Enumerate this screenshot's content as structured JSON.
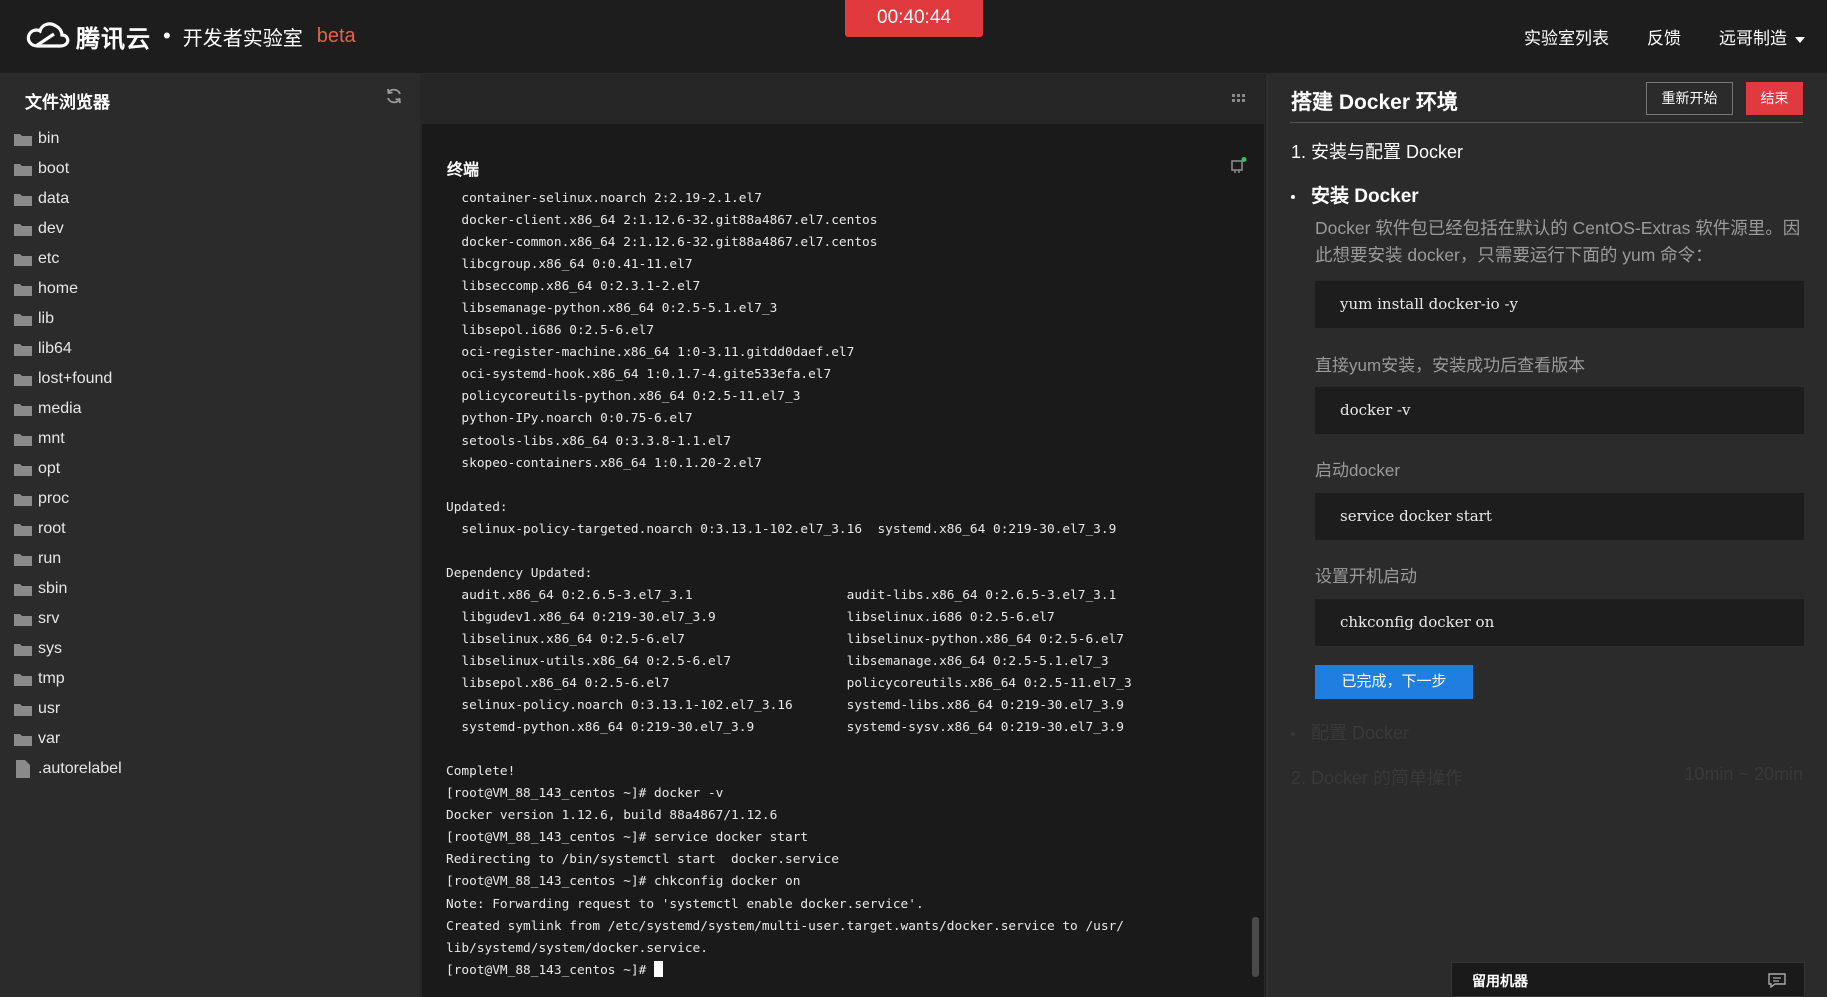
{
  "header": {
    "brand": "腾讯云",
    "separator": "•",
    "subtitle": "开发者实验室",
    "beta": "beta",
    "timer": "00:40:44",
    "nav": [
      "实验室列表",
      "反馈",
      "远哥制造"
    ]
  },
  "file_browser": {
    "title": "文件浏览器",
    "items": [
      {
        "name": "bin",
        "type": "folder"
      },
      {
        "name": "boot",
        "type": "folder"
      },
      {
        "name": "data",
        "type": "folder"
      },
      {
        "name": "dev",
        "type": "folder"
      },
      {
        "name": "etc",
        "type": "folder"
      },
      {
        "name": "home",
        "type": "folder"
      },
      {
        "name": "lib",
        "type": "folder"
      },
      {
        "name": "lib64",
        "type": "folder"
      },
      {
        "name": "lost+found",
        "type": "folder"
      },
      {
        "name": "media",
        "type": "folder"
      },
      {
        "name": "mnt",
        "type": "folder"
      },
      {
        "name": "opt",
        "type": "folder"
      },
      {
        "name": "proc",
        "type": "folder"
      },
      {
        "name": "root",
        "type": "folder"
      },
      {
        "name": "run",
        "type": "folder"
      },
      {
        "name": "sbin",
        "type": "folder"
      },
      {
        "name": "srv",
        "type": "folder"
      },
      {
        "name": "sys",
        "type": "folder"
      },
      {
        "name": "tmp",
        "type": "folder"
      },
      {
        "name": "usr",
        "type": "folder"
      },
      {
        "name": "var",
        "type": "folder"
      },
      {
        "name": ".autorelabel",
        "type": "file"
      }
    ]
  },
  "terminal": {
    "title": "终端",
    "lines": [
      "  container-selinux.noarch 2:2.19-2.1.el7",
      "  docker-client.x86_64 2:1.12.6-32.git88a4867.el7.centos",
      "  docker-common.x86_64 2:1.12.6-32.git88a4867.el7.centos",
      "  libcgroup.x86_64 0:0.41-11.el7",
      "  libseccomp.x86_64 0:2.3.1-2.el7",
      "  libsemanage-python.x86_64 0:2.5-5.1.el7_3",
      "  libsepol.i686 0:2.5-6.el7",
      "  oci-register-machine.x86_64 1:0-3.11.gitdd0daef.el7",
      "  oci-systemd-hook.x86_64 1:0.1.7-4.gite533efa.el7",
      "  policycoreutils-python.x86_64 0:2.5-11.el7_3",
      "  python-IPy.noarch 0:0.75-6.el7",
      "  setools-libs.x86_64 0:3.3.8-1.1.el7",
      "  skopeo-containers.x86_64 1:0.1.20-2.el7",
      "",
      "Updated:",
      "  selinux-policy-targeted.noarch 0:3.13.1-102.el7_3.16  systemd.x86_64 0:219-30.el7_3.9",
      "",
      "Dependency Updated:",
      "  audit.x86_64 0:2.6.5-3.el7_3.1                    audit-libs.x86_64 0:2.6.5-3.el7_3.1",
      "  libgudev1.x86_64 0:219-30.el7_3.9                 libselinux.i686 0:2.5-6.el7",
      "  libselinux.x86_64 0:2.5-6.el7                     libselinux-python.x86_64 0:2.5-6.el7",
      "  libselinux-utils.x86_64 0:2.5-6.el7               libsemanage.x86_64 0:2.5-5.1.el7_3",
      "  libsepol.x86_64 0:2.5-6.el7                       policycoreutils.x86_64 0:2.5-11.el7_3",
      "  selinux-policy.noarch 0:3.13.1-102.el7_3.16       systemd-libs.x86_64 0:219-30.el7_3.9",
      "  systemd-python.x86_64 0:219-30.el7_3.9            systemd-sysv.x86_64 0:219-30.el7_3.9",
      "",
      "Complete!",
      "[root@VM_88_143_centos ~]# docker -v",
      "Docker version 1.12.6, build 88a4867/1.12.6",
      "[root@VM_88_143_centos ~]# service docker start",
      "Redirecting to /bin/systemctl start  docker.service",
      "[root@VM_88_143_centos ~]# chkconfig docker on",
      "Note: Forwarding request to 'systemctl enable docker.service'.",
      "Created symlink from /etc/systemd/system/multi-user.target.wants/docker.service to /usr/",
      "lib/systemd/system/docker.service."
    ],
    "prompt": "[root@VM_88_143_centos ~]# "
  },
  "tutorial": {
    "title": "搭建 Docker 环境",
    "restart_label": "重新开始",
    "end_label": "结束",
    "step1": "1. 安装与配置 Docker",
    "sub1": "安装 Docker",
    "desc": "Docker 软件包已经包括在默认的 CentOS-Extras 软件源里。因此想要安装 docker，只需要运行下面的 yum 命令：",
    "code1": "yum install docker-io -y",
    "text2": "直接yum安装，安装成功后查看版本",
    "code2": "docker -v",
    "text3": "启动docker",
    "code3": "service docker start",
    "text4": "设置开机启动",
    "code4": "chkconfig docker on",
    "next_label": "已完成，下一步",
    "sub2": "配置 Docker",
    "step2": "2. Docker 的简单操作",
    "step2_time": "10min ~ 20min",
    "keep_label": "留用机器"
  },
  "colors": {
    "accent_red": "#e0393e",
    "accent_blue": "#1f7ee0",
    "beta_orange": "#e8604a",
    "folder": "#8a8a8a"
  },
  "icons": [
    "tencent-cloud-logo-icon",
    "refresh-icon",
    "grid-icon",
    "terminal-status-icon",
    "folder-icon",
    "file-icon",
    "chat-icon",
    "chevron-down-icon"
  ]
}
